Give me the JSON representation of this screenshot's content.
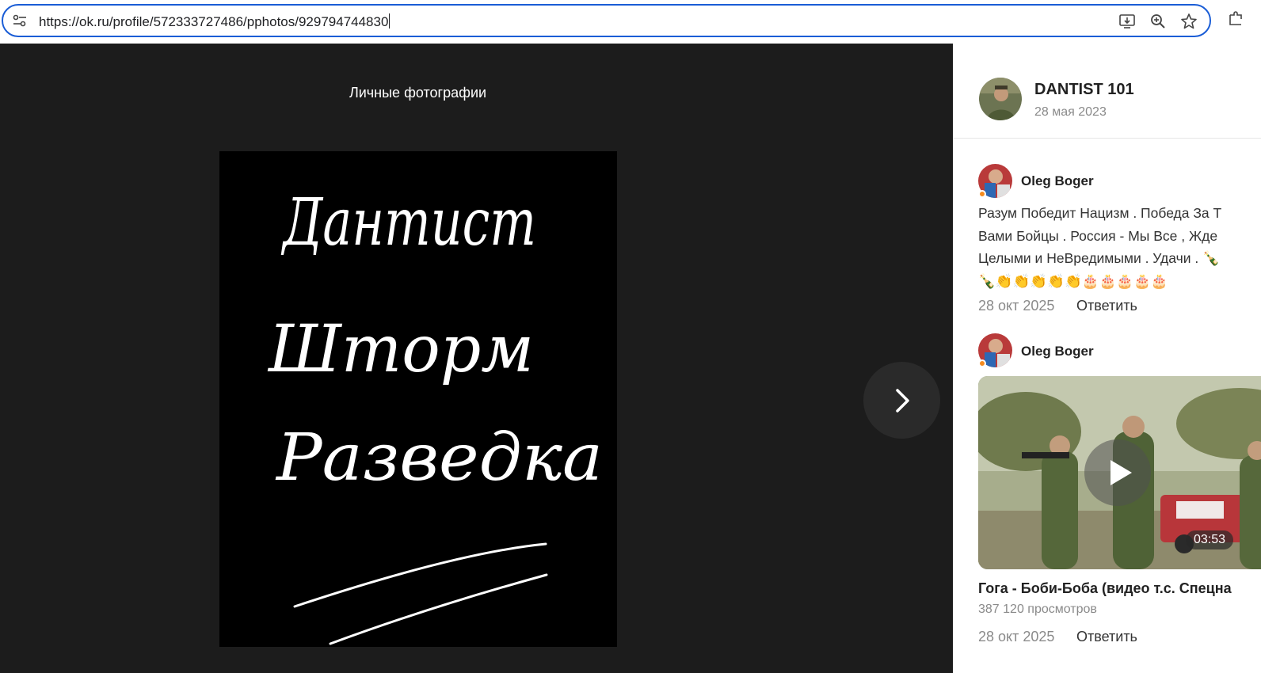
{
  "browser": {
    "url": "https://ok.ru/profile/572333727486/pphotos/929794744830",
    "icons": [
      "site-settings-icon",
      "install-app-icon",
      "zoom-icon",
      "bookmark-star-icon",
      "extensions-icon"
    ]
  },
  "viewer": {
    "album_title": "Личные фотографии",
    "photo_lines": [
      "Дантист",
      "Шторм",
      "Разведка"
    ],
    "next_icon": "chevron-right-icon"
  },
  "panel": {
    "owner": {
      "name": "DANTIST 101",
      "date": "28 мая 2023"
    },
    "comments": [
      {
        "author": "Oleg Boger",
        "lines": [
          "Разум Победит Нацизм . Победа За Т",
          "Вами Бойцы . Россия - Мы Все , Жде",
          "Целыми и НеВредимыми . Удачи . 🍾",
          "🍾👏👏👏👏👏🎂🎂🎂🎂🎂"
        ],
        "date": "28 окт 2025",
        "reply": "Ответить"
      },
      {
        "author": "Oleg Boger",
        "video": {
          "duration": "03:53",
          "title": "Гога - Боби-Боба (видео т.с. Спецна",
          "views": "387 120 просмотров"
        },
        "date": "28 окт 2025",
        "reply": "Ответить"
      }
    ]
  },
  "colors": {
    "omnibox_border": "#1a5dd6",
    "viewer_bg": "#1c1c1c",
    "online_dot": "#f58b1f"
  }
}
